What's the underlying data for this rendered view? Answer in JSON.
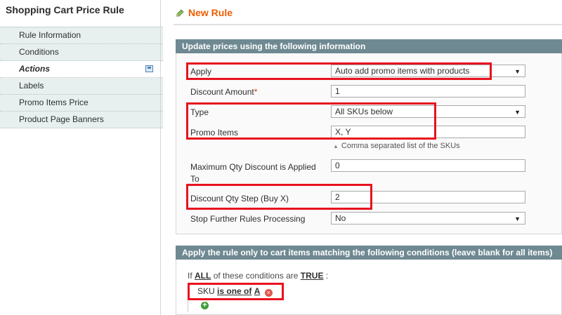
{
  "sidebar": {
    "title": "Shopping Cart Price Rule",
    "tabs": [
      {
        "label": "Rule Information"
      },
      {
        "label": "Conditions"
      },
      {
        "label": "Actions"
      },
      {
        "label": "Labels"
      },
      {
        "label": "Promo Items Price"
      },
      {
        "label": "Product Page Banners"
      }
    ]
  },
  "header": {
    "title": "New Rule"
  },
  "actions_section": {
    "heading": "Update prices using the following information",
    "apply": {
      "label": "Apply",
      "value": "Auto add promo items with products"
    },
    "discount_amount": {
      "label": "Discount Amount",
      "required_mark": "*",
      "value": "1"
    },
    "type": {
      "label": "Type",
      "value": "All SKUs below"
    },
    "promo_items": {
      "label": "Promo Items",
      "value": "X, Y",
      "note": "Comma separated list of the SKUs"
    },
    "max_qty": {
      "label_line1": "Maximum Qty Discount is Applied",
      "label_line2": "To",
      "value": "0"
    },
    "discount_step": {
      "label": "Discount Qty Step (Buy X)",
      "value": "2"
    },
    "stop_rules": {
      "label": "Stop Further Rules Processing",
      "value": "No"
    }
  },
  "conditions_section": {
    "heading": "Apply the rule only to cart items matching the following conditions (leave blank for all items)",
    "if_text": "If",
    "aggregator": "ALL",
    "middle_text": "of these conditions are",
    "value": "TRUE",
    "suffix": ":",
    "condition": {
      "attribute": "SKU",
      "operator": "is one of",
      "value": "A"
    }
  },
  "colors": {
    "accent": "#eb5e00",
    "section_header": "#6f8992",
    "highlight": "#e8121e"
  },
  "icons": {
    "save": "save-icon",
    "pencil": "pencil-icon",
    "remove": "remove-icon",
    "add": "add-icon"
  }
}
